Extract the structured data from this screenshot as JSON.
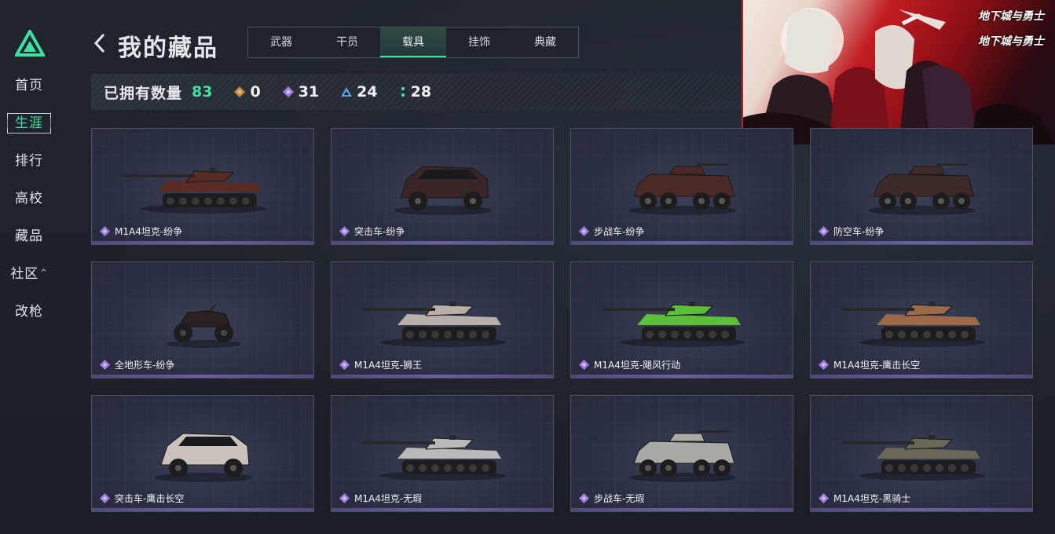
{
  "sidebar": {
    "logo": "triangle-logo",
    "items": [
      {
        "label": "首页",
        "active": false
      },
      {
        "label": "生涯",
        "active": true
      },
      {
        "label": "排行",
        "active": false
      },
      {
        "label": "高校",
        "active": false
      },
      {
        "label": "藏品",
        "active": false
      },
      {
        "label": "社区",
        "active": false,
        "caret": "^"
      },
      {
        "label": "改枪",
        "active": false
      }
    ]
  },
  "header": {
    "title": "我的藏品",
    "tabs": [
      {
        "label": "武器",
        "active": false
      },
      {
        "label": "干员",
        "active": false
      },
      {
        "label": "载具",
        "active": true
      },
      {
        "label": "挂饰",
        "active": false
      },
      {
        "label": "典藏",
        "active": false
      }
    ]
  },
  "stats": {
    "owned_label": "已拥有数量",
    "owned_count": "83",
    "items": [
      {
        "icon": "gold-diamond-icon",
        "color": "#c08a4a",
        "value": "0"
      },
      {
        "icon": "purple-diamond-icon",
        "color": "#9b7be0",
        "value": "31"
      },
      {
        "icon": "blue-triangle-icon",
        "color": "#5aa0e0",
        "value": "24"
      },
      {
        "icon": "green-dots-icon",
        "color": "#3fe0a0",
        "value": "28"
      }
    ]
  },
  "banner": {
    "logo_text_1": "地下城与勇士",
    "logo_text_2": "地下城与勇士"
  },
  "vehicles": [
    {
      "name": "M1A4坦克-纷争",
      "kind": "tank",
      "color": "#5a2a24"
    },
    {
      "name": "突击车-纷争",
      "kind": "suv",
      "color": "#3a2626"
    },
    {
      "name": "步战车-纷争",
      "kind": "apc",
      "color": "#4a2a26"
    },
    {
      "name": "防空车-纷争",
      "kind": "apc",
      "color": "#3e2a28"
    },
    {
      "name": "全地形车-纷争",
      "kind": "atv",
      "color": "#2a2222"
    },
    {
      "name": "M1A4坦克-狮王",
      "kind": "tank",
      "color": "#b8b0a8"
    },
    {
      "name": "M1A4坦克-飓风行动",
      "kind": "tank",
      "color": "#5bbf3a"
    },
    {
      "name": "M1A4坦克-鹰击长空",
      "kind": "tank",
      "color": "#9a6a4a"
    },
    {
      "name": "突击车-鹰击长空",
      "kind": "suv",
      "color": "#c8c2ba"
    },
    {
      "name": "M1A4坦克-无瑕",
      "kind": "tank",
      "color": "#b8bab8"
    },
    {
      "name": "步战车-无瑕",
      "kind": "apc",
      "color": "#a8aaa6"
    },
    {
      "name": "M1A4坦克-黑骑士",
      "kind": "tank",
      "color": "#6a6658"
    }
  ],
  "colors": {
    "accent": "#3fe0a0",
    "rarity_purple": "#9b7be0"
  }
}
